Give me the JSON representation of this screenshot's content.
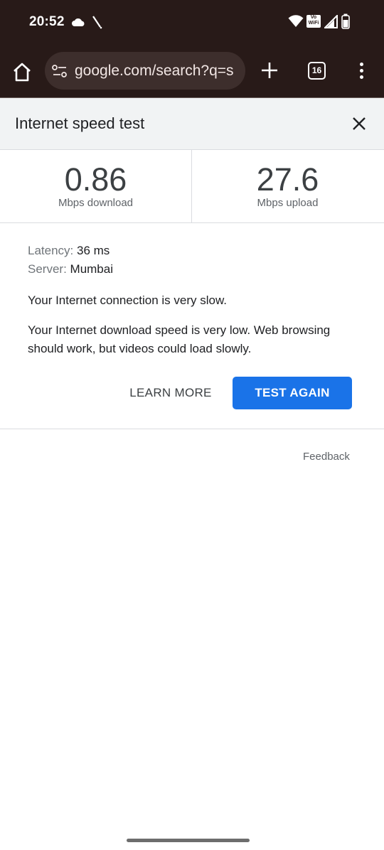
{
  "status_bar": {
    "time": "20:52",
    "icons": [
      "cloud-icon",
      "signal-slash-icon",
      "wifi-icon",
      "vowifi-icon",
      "cell-signal-icon",
      "battery-icon"
    ],
    "vowifi_label": "Vo WiFi"
  },
  "browser": {
    "url": "google.com/search?q=s",
    "tab_count": "16"
  },
  "card": {
    "title": "Internet speed test",
    "download": {
      "value": "0.86",
      "unit": "Mbps download"
    },
    "upload": {
      "value": "27.6",
      "unit": "Mbps upload"
    },
    "latency_label": "Latency:",
    "latency_value": "36 ms",
    "server_label": "Server:",
    "server_value": "Mumbai",
    "message1": "Your Internet connection is very slow.",
    "message2": "Your Internet download speed is very low. Web browsing should work, but videos could load slowly.",
    "learn_more": "LEARN MORE",
    "test_again": "TEST AGAIN",
    "feedback": "Feedback"
  },
  "colors": {
    "toolbar_bg": "#281a18",
    "omnibox_bg": "#3d2e2c",
    "accent": "#1a73e8",
    "header_bg": "#f1f3f4"
  }
}
